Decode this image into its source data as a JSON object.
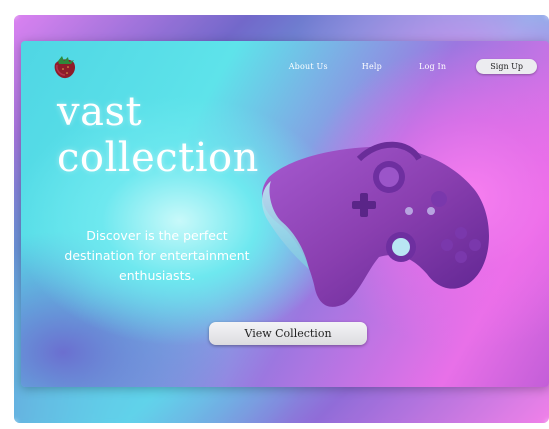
{
  "nav": {
    "about_label": "About Us",
    "help_label": "Help",
    "login_label": "Log In",
    "signup_label": "Sign Up"
  },
  "hero": {
    "title_line1": "vast",
    "title_line2": "collection",
    "description": "Discover is the perfect destination for entertainment enthusiasts.",
    "cta_label": "View Collection"
  },
  "icons": {
    "logo": "strawberry-logo-icon",
    "hero_image": "game-controller-icon"
  },
  "colors": {
    "cyan": "#5ee3ea",
    "magenta": "#e870e8",
    "controller_purple": "#8a3fb0",
    "button_bg": "#ececf0"
  }
}
